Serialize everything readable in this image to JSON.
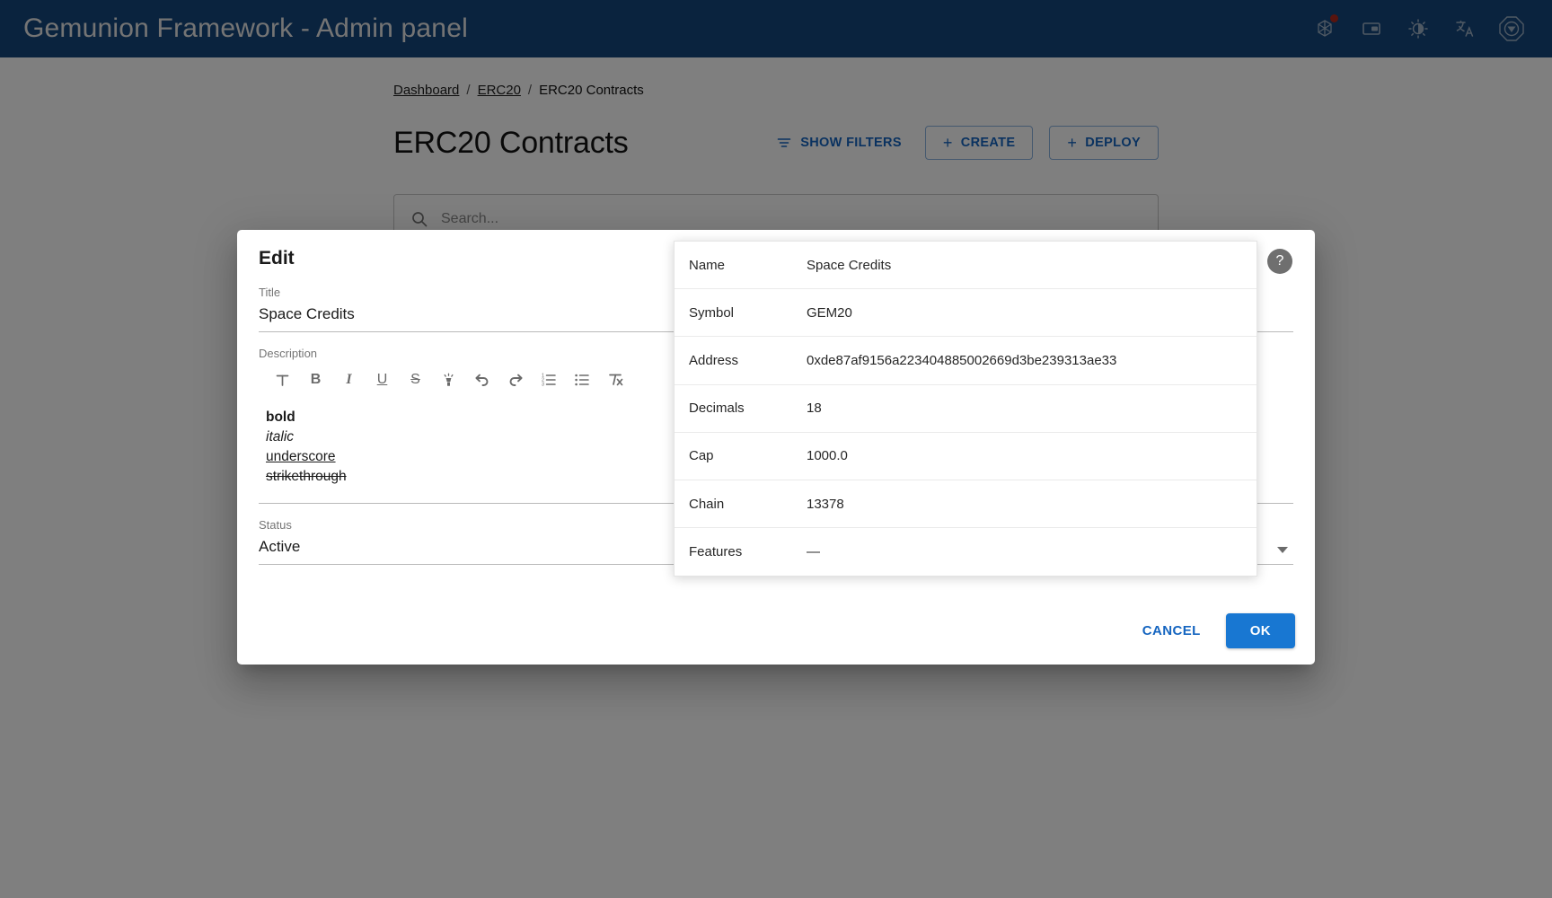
{
  "appbar": {
    "title": "Gemunion Framework - Admin panel",
    "icons": [
      {
        "name": "network-icon",
        "badge": true
      },
      {
        "name": "wallet-icon",
        "badge": false
      },
      {
        "name": "theme-toggle-icon",
        "badge": false
      },
      {
        "name": "language-icon",
        "badge": false
      },
      {
        "name": "logo-icon",
        "badge": false
      }
    ]
  },
  "breadcrumb": {
    "items": [
      {
        "label": "Dashboard",
        "link": true
      },
      {
        "label": "ERC20",
        "link": true
      },
      {
        "label": "ERC20 Contracts",
        "link": false
      }
    ],
    "separator": "/"
  },
  "page": {
    "title": "ERC20 Contracts",
    "show_filters_label": "SHOW FILTERS",
    "create_label": "CREATE",
    "deploy_label": "DEPLOY",
    "plus_glyph": "+"
  },
  "search": {
    "placeholder": "Search...",
    "value": ""
  },
  "dialog": {
    "title": "Edit",
    "help_glyph": "?",
    "title_field": {
      "label": "Title",
      "value": "Space Credits"
    },
    "description_field": {
      "label": "Description",
      "toolbar": [
        {
          "name": "text-format-icon",
          "glyph": "T",
          "title": "Text"
        },
        {
          "name": "bold-icon",
          "glyph": "B",
          "title": "Bold"
        },
        {
          "name": "italic-icon",
          "glyph": "I",
          "title": "Italic"
        },
        {
          "name": "underline-icon",
          "glyph": "U",
          "title": "Underline"
        },
        {
          "name": "strikethrough-icon",
          "glyph": "S",
          "title": "Strikethrough"
        },
        {
          "name": "highlight-icon",
          "glyph": "",
          "title": "Highlight"
        },
        {
          "name": "undo-icon",
          "glyph": "",
          "title": "Undo"
        },
        {
          "name": "redo-icon",
          "glyph": "",
          "title": "Redo"
        },
        {
          "name": "numbered-list-icon",
          "glyph": "",
          "title": "Numbered list"
        },
        {
          "name": "bullet-list-icon",
          "glyph": "",
          "title": "Bulleted list"
        },
        {
          "name": "clear-format-icon",
          "glyph": "",
          "title": "Clear formatting"
        }
      ],
      "lines": [
        {
          "text": "bold",
          "style": "bold"
        },
        {
          "text": "italic",
          "style": "italic"
        },
        {
          "text": "underscore",
          "style": "underline"
        },
        {
          "text": "strikethrough",
          "style": "strikethrough"
        }
      ]
    },
    "status_field": {
      "label": "Status",
      "value": "Active"
    },
    "cancel_label": "CANCEL",
    "ok_label": "OK"
  },
  "info_panel": {
    "rows": [
      {
        "key": "Name",
        "value": "Space Credits"
      },
      {
        "key": "Symbol",
        "value": "GEM20"
      },
      {
        "key": "Address",
        "value": "0xde87af9156a223404885002669d3be239313ae33"
      },
      {
        "key": "Decimals",
        "value": "18"
      },
      {
        "key": "Cap",
        "value": "1000.0"
      },
      {
        "key": "Chain",
        "value": "13378"
      },
      {
        "key": "Features",
        "value": "—"
      }
    ]
  },
  "colors": {
    "appbar": "#15467d",
    "accent": "#1565c0",
    "primary_button": "#1877d2",
    "badge": "#b0281c"
  }
}
